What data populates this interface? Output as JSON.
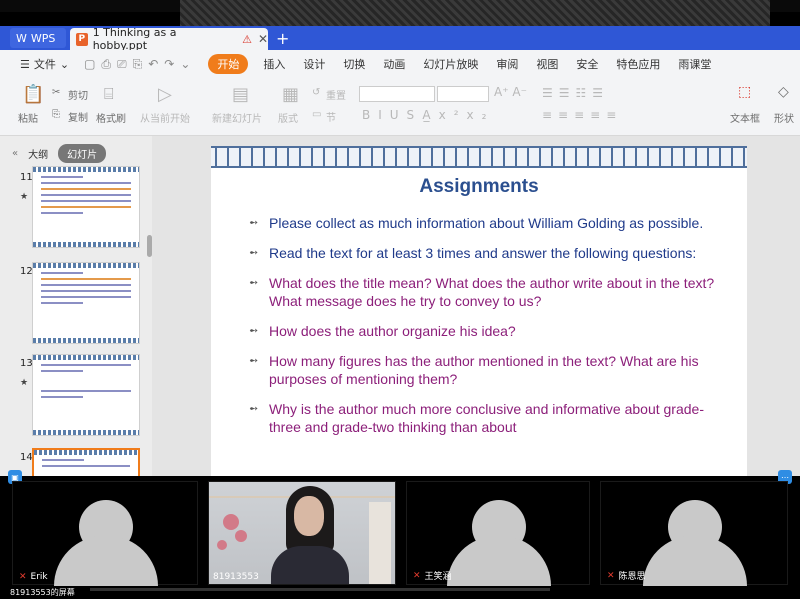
{
  "tabs": {
    "wps_label": "WPS",
    "doc_badge": "P",
    "doc_title": "1 Thinking as a hobby.ppt",
    "plus": "+"
  },
  "menu": {
    "file": "文件",
    "items": [
      "开始",
      "插入",
      "设计",
      "切换",
      "动画",
      "幻灯片放映",
      "审阅",
      "视图",
      "安全",
      "特色应用",
      "雨课堂"
    ]
  },
  "ribbon": {
    "paste": "粘贴",
    "cut": "剪切",
    "copy": "复制",
    "format_painter": "格式刷",
    "from_current": "从当前开始",
    "new_slide": "新建幻灯片",
    "layout": "版式",
    "section": "节",
    "reset": "重置",
    "textbox": "文本框",
    "shape": "形状"
  },
  "left_panel": {
    "tab_outline": "大纲",
    "tab_slides": "幻灯片",
    "thumbnails": [
      {
        "num": "11"
      },
      {
        "num": "12"
      },
      {
        "num": "13"
      },
      {
        "num": "14"
      }
    ]
  },
  "slide": {
    "title": "Assignments",
    "bullets": [
      {
        "text": "Please collect as much information about William Golding as possible.",
        "color": "#1f3a8a"
      },
      {
        "text": "Read the text for at least 3 times and answer the following questions:",
        "color": "#1f3a8a"
      },
      {
        "text": "What does the title mean? What does the author write about in the text? What message does he try to convey to us?",
        "color": "#8c1f7a"
      },
      {
        "text": "How does the author organize his idea?",
        "color": "#8c1f7a"
      },
      {
        "text": "How many figures has the author mentioned in the text? What are his purposes of mentioning them?",
        "color": "#8c1f7a"
      },
      {
        "text": "Why is the author much more conclusive and informative about grade-three and grade-two thinking than about",
        "color": "#8c1f7a"
      }
    ]
  },
  "participants": [
    {
      "name": "Erik"
    },
    {
      "name": "81913553"
    },
    {
      "name": "王笑涵"
    },
    {
      "name": "陈恩思"
    }
  ],
  "footer": {
    "caption": "81913553的屏幕"
  },
  "colors": {
    "tab_bar": "#2f57d6",
    "start_tab": "#f07c1b",
    "slide_title": "#2b4f8f",
    "bullet_blue": "#1f3a8a",
    "bullet_purple": "#8c1f7a"
  }
}
